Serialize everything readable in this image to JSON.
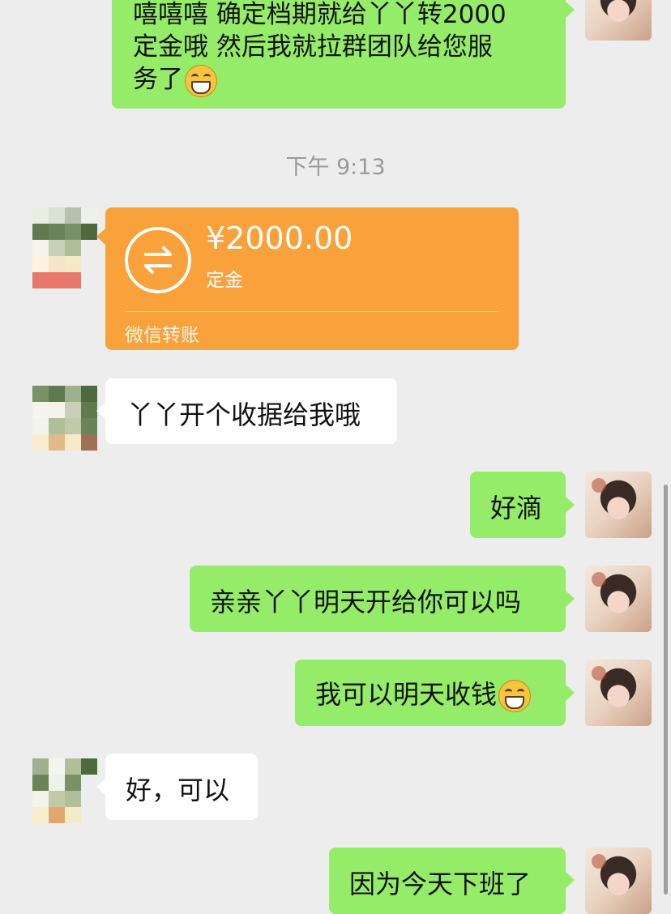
{
  "messages": {
    "m1": {
      "text_lines": [
        "嘻嘻嘻 确定档期就给丫丫转2000",
        "定金哦 然后我就拉群团队给您服",
        "务了"
      ]
    },
    "time_divider": "下午 9:13",
    "transfer": {
      "amount": "¥2000.00",
      "note": "定金",
      "brand": "微信转账"
    },
    "m2": {
      "text": "丫丫开个收据给我哦"
    },
    "m3": {
      "text": "好滴"
    },
    "m4": {
      "text": "亲亲丫丫明天开给你可以吗"
    },
    "m5": {
      "text": "我可以明天收钱"
    },
    "m6": {
      "text": "好，可以"
    },
    "m7": {
      "text": "因为今天下班了"
    }
  },
  "icons": {
    "transfer": "transfer-arrows-icon",
    "emoji": "grin-emoji-icon"
  },
  "colors": {
    "background": "#ededed",
    "outgoing_bubble": "#95ec69",
    "incoming_bubble": "#ffffff",
    "transfer_card": "#f9a13a",
    "timestamp_text": "#9a9a9a"
  }
}
